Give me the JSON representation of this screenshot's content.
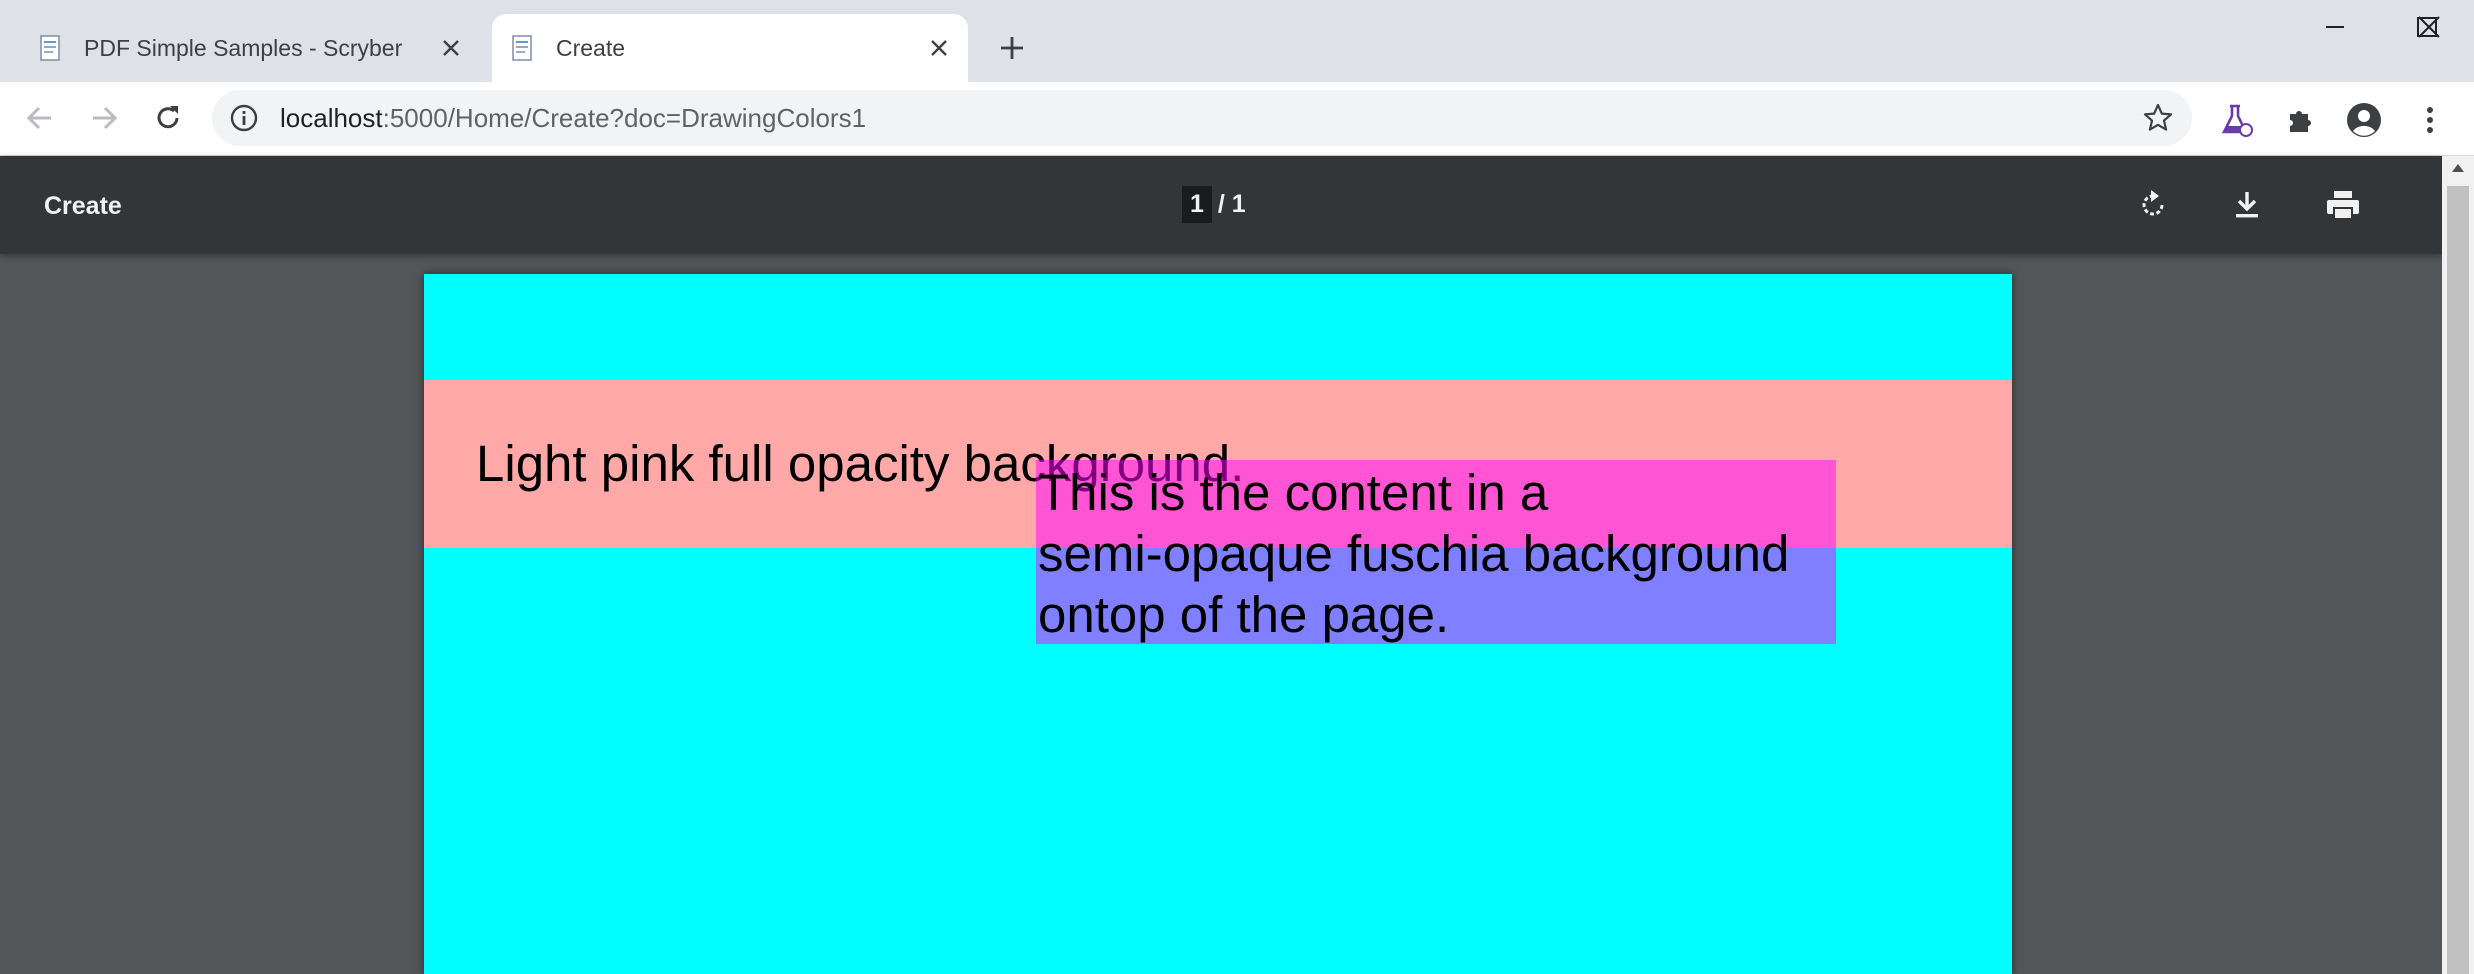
{
  "tabs": [
    {
      "title": "PDF Simple Samples - Scryber",
      "active": false
    },
    {
      "title": "Create",
      "active": true
    }
  ],
  "address_bar": {
    "host": "localhost",
    "path": ":5000/Home/Create?doc=DrawingColors1"
  },
  "icons": {
    "back": "back-arrow-icon",
    "forward": "forward-arrow-icon",
    "reload": "reload-icon",
    "info": "info-icon",
    "bookmark": "star-icon",
    "labs": "flask-icon",
    "extensions": "puzzle-icon",
    "profile": "account-icon",
    "menu": "kebab-menu-icon",
    "rotate": "rotate-icon",
    "download": "download-icon",
    "print": "print-icon"
  },
  "pdf_viewer": {
    "title": "Create",
    "current_page": "1",
    "page_separator": "/ 1"
  },
  "document": {
    "colors": {
      "page_background": "#00ffff",
      "band_background": "#ffa8a8",
      "overlay_background": "#ff00ff",
      "overlay_opacity": "0.5"
    },
    "pink_text": "Light pink full opacity background.",
    "overlay_lines": [
      "This is the content in a",
      "semi-opaque fuschia background",
      "ontop of the page."
    ]
  }
}
